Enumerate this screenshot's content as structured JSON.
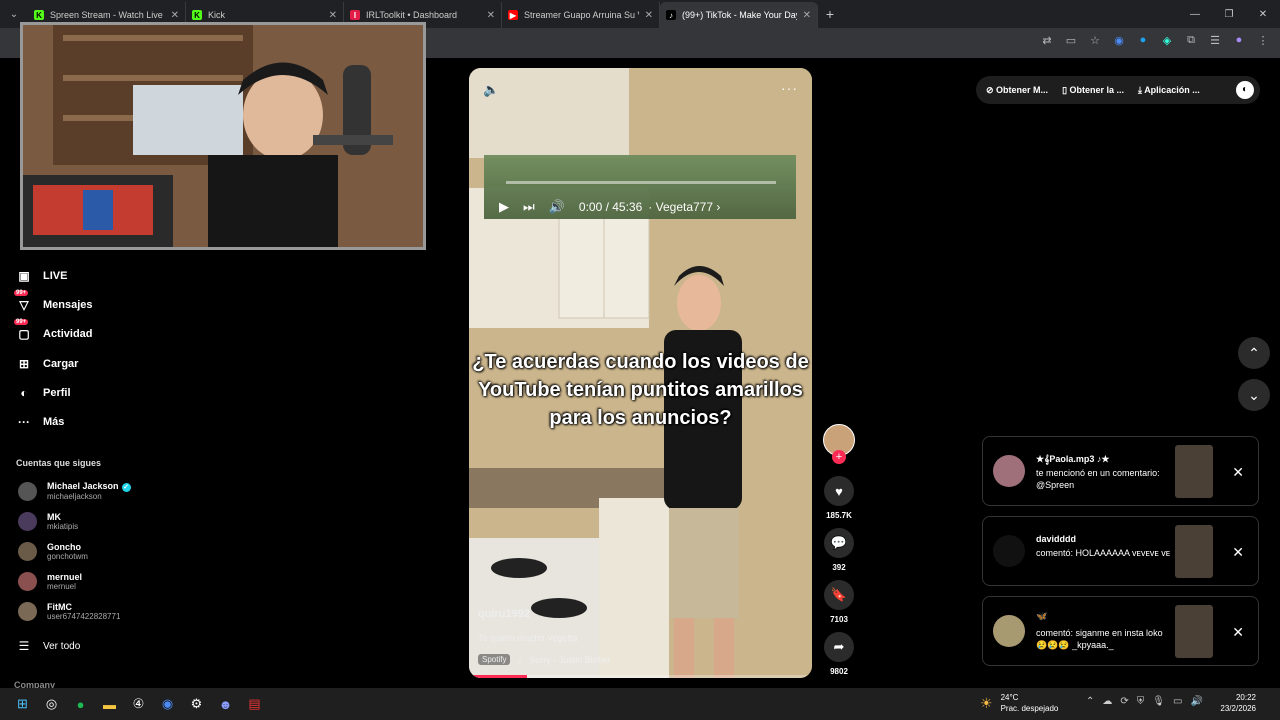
{
  "browser": {
    "tabs": [
      {
        "title": "Spreen Stream - Watch Live on",
        "favicon": "kick",
        "color": "#53fc18",
        "active": false
      },
      {
        "title": "Kick",
        "favicon": "kick",
        "color": "#53fc18",
        "active": false
      },
      {
        "title": "IRLToolkit • Dashboard",
        "favicon": "irltoolkit",
        "color": "#e11d48",
        "active": false
      },
      {
        "title": "Streamer Guapo Arruina Su Vid",
        "favicon": "youtube",
        "color": "#ff0000",
        "active": false
      },
      {
        "title": "(99+) TikTok - Make Your Day",
        "favicon": "tiktok",
        "color": "#000000",
        "active": true
      }
    ],
    "new_tab": "+"
  },
  "sidebar": {
    "nav": [
      {
        "label": "LIVE",
        "icon": "live-icon",
        "badge": ""
      },
      {
        "label": "Mensajes",
        "icon": "messages-icon",
        "badge": "99+"
      },
      {
        "label": "Actividad",
        "icon": "activity-icon",
        "badge": "99+"
      },
      {
        "label": "Cargar",
        "icon": "upload-icon",
        "badge": ""
      },
      {
        "label": "Perfil",
        "icon": "profile-icon",
        "badge": ""
      },
      {
        "label": "Más",
        "icon": "more-icon",
        "badge": ""
      }
    ],
    "following_title": "Cuentas que sigues",
    "accounts": [
      {
        "name": "Michael Jackson",
        "user": "michaeljackson",
        "verified": true
      },
      {
        "name": "MK",
        "user": "mkiatipis",
        "verified": false
      },
      {
        "name": "Goncho",
        "user": "gonchotwm",
        "verified": false
      },
      {
        "name": "mernuel",
        "user": "mernuel",
        "verified": false
      },
      {
        "name": "FitMC",
        "user": "user6747422828771",
        "verified": false
      }
    ],
    "see_all": "Ver todo",
    "company": "Company"
  },
  "video": {
    "caption": "¿Te acuerdas cuando los videos de YouTube tenían puntitos amarillos para los anuncios?",
    "youtube_overlay": {
      "time": "0:00 / 45:36",
      "channel": "Vegeta777"
    },
    "author": "quiru1992",
    "description": "Te quiero mucho Vegetta",
    "music_source": "Spotify",
    "music": "Sorry - Justin Bieber",
    "progress": 0.17
  },
  "actions": {
    "likes": "185.7K",
    "comments": "392",
    "saves": "7103",
    "shares": "9802"
  },
  "top_buttons": {
    "coins": "Obtener M...",
    "app": "Obtener la ...",
    "desktop": "Aplicación ..."
  },
  "notifications": [
    {
      "name": "★𝄞Paola.mp3 ♪★",
      "text": "te mencionó en un comentario: @Spreen"
    },
    {
      "name": "davidddd",
      "text": "comentó: HOLAAAAAA ᴠᴇᴠᴇᴠᴇ ᴠᴇ"
    },
    {
      "name": "🦋",
      "text": "comentó: siganme en insta loko 😢😢😢 _kpyaaa._"
    }
  ],
  "taskbar": {
    "weather_temp": "24°C",
    "weather_desc": "Prac. despejado",
    "time": "20:22",
    "date": "23/2/2026"
  }
}
